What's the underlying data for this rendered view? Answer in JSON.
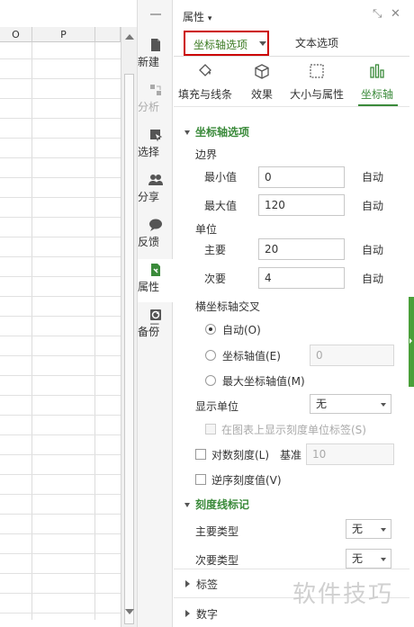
{
  "sheet": {
    "columns": [
      "O",
      "P"
    ]
  },
  "sidebar": {
    "items": [
      {
        "label": "新建",
        "icon": "new-doc-icon"
      },
      {
        "label": "分析",
        "icon": "analysis-icon"
      },
      {
        "label": "选择",
        "icon": "select-icon"
      },
      {
        "label": "分享",
        "icon": "share-icon"
      },
      {
        "label": "反馈",
        "icon": "feedback-icon"
      },
      {
        "label": "属性",
        "icon": "properties-icon"
      },
      {
        "label": "备份",
        "icon": "backup-icon"
      }
    ]
  },
  "panel": {
    "title": "属性",
    "tabs": [
      "坐标轴选项",
      "文本选项"
    ],
    "subtabs": [
      "填充与线条",
      "效果",
      "大小与属性",
      "坐标轴"
    ],
    "section_axis": "坐标轴选项",
    "bounds_label": "边界",
    "min_label": "最小值",
    "min_value": "0",
    "max_label": "最大值",
    "max_value": "120",
    "unit_label": "单位",
    "major_label": "主要",
    "major_value": "20",
    "minor_label": "次要",
    "minor_value": "4",
    "auto": "自动",
    "cross_label": "横坐标轴交叉",
    "cross_auto": "自动(O)",
    "cross_value": "坐标轴值(E)",
    "cross_value_input": "0",
    "cross_max": "最大坐标轴值(M)",
    "display_unit_label": "显示单位",
    "display_unit_value": "无",
    "show_unit_label": "在图表上显示刻度单位标签(S)",
    "log_scale": "对数刻度(L)",
    "base_label": "基准",
    "base_value": "10",
    "reverse": "逆序刻度值(V)",
    "section_tick": "刻度线标记",
    "major_type_label": "主要类型",
    "major_type_value": "无",
    "minor_type_label": "次要类型",
    "minor_type_value": "无",
    "labels_section": "标签",
    "numbers_section": "数字"
  },
  "watermark": "软件技巧",
  "colors": {
    "accent": "#3a8a3a",
    "highlight": "#cc0000"
  }
}
